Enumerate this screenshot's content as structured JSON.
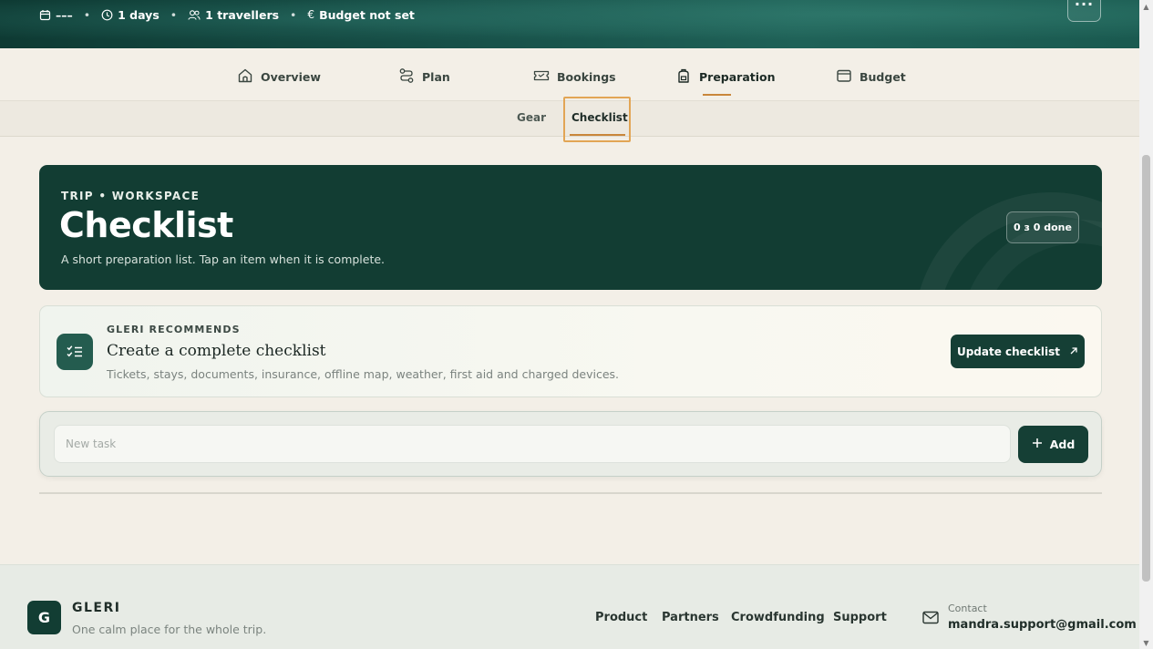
{
  "trip_meta": {
    "dates": "–––",
    "duration": "1 days",
    "travellers": "1 travellers",
    "budget": "Budget not set",
    "separator": "•",
    "more_label": "···"
  },
  "main_tabs": [
    {
      "label": "Overview",
      "icon": "home-icon"
    },
    {
      "label": "Plan",
      "icon": "route-icon"
    },
    {
      "label": "Bookings",
      "icon": "ticket-icon"
    },
    {
      "label": "Preparation",
      "icon": "backpack-icon",
      "active": true
    },
    {
      "label": "Budget",
      "icon": "wallet-icon"
    }
  ],
  "sub_tabs": [
    {
      "label": "Gear"
    },
    {
      "label": "Checklist",
      "active": true
    }
  ],
  "hero": {
    "kicker": "TRIP • WORKSPACE",
    "title": "Checklist",
    "subtitle": "A short preparation list. Tap an item when it is complete.",
    "badge": "0 з 0 done"
  },
  "recommendation": {
    "kicker": "GLERI RECOMMENDS",
    "title": "Create a complete checklist",
    "description": "Tickets, stays, documents, insurance, offline map, weather, first aid and charged devices.",
    "button_label": "Update checklist",
    "icon": "checklist-icon"
  },
  "new_task": {
    "placeholder": "New task",
    "value": "",
    "add_label": "Add"
  },
  "footer": {
    "logo_letter": "G",
    "brand": "GLERI",
    "tagline": "One calm place for the whole trip.",
    "links": [
      "Product",
      "Partners",
      "Crowdfunding",
      "Support"
    ],
    "contact_label": "Contact",
    "contact_email": "mandra.support@gmail.com"
  },
  "colors": {
    "brand_dark": "#123d33",
    "accent": "#c9863b",
    "focus_ring": "#e2a555",
    "background": "#f3efe7"
  }
}
